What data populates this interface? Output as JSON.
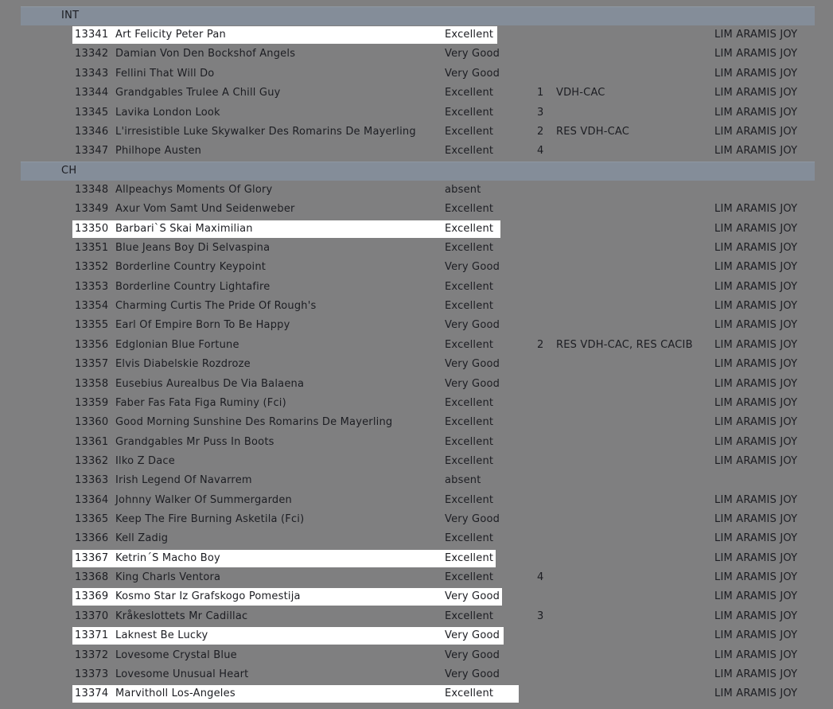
{
  "groups": [
    {
      "label": "INT",
      "entries": [
        {
          "no": "13341",
          "name": "Art Felicity Peter Pan",
          "grade": "Excellent",
          "rank": "",
          "award": "",
          "judge": "LIM ARAMIS JOY",
          "highlighted": true
        },
        {
          "no": "13342",
          "name": "Damian Von Den Bockshof Angels",
          "grade": "Very Good",
          "rank": "",
          "award": "",
          "judge": "LIM ARAMIS JOY",
          "highlighted": false
        },
        {
          "no": "13343",
          "name": "Fellini That Will Do",
          "grade": "Very Good",
          "rank": "",
          "award": "",
          "judge": "LIM ARAMIS JOY",
          "highlighted": false
        },
        {
          "no": "13344",
          "name": "Grandgables Trulee A Chill Guy",
          "grade": "Excellent",
          "rank": "1",
          "award": "VDH-CAC",
          "judge": "LIM ARAMIS JOY",
          "highlighted": false
        },
        {
          "no": "13345",
          "name": "Lavika London Look",
          "grade": "Excellent",
          "rank": "3",
          "award": "",
          "judge": "LIM ARAMIS JOY",
          "highlighted": false
        },
        {
          "no": "13346",
          "name": "L'irresistible Luke Skywalker Des Romarins De Mayerling",
          "grade": "Excellent",
          "rank": "2",
          "award": "RES VDH-CAC",
          "judge": "LIM ARAMIS JOY",
          "highlighted": false
        },
        {
          "no": "13347",
          "name": "Philhope Austen",
          "grade": "Excellent",
          "rank": "4",
          "award": "",
          "judge": "LIM ARAMIS JOY",
          "highlighted": false
        }
      ]
    },
    {
      "label": "CH",
      "entries": [
        {
          "no": "13348",
          "name": "Allpeachys Moments Of Glory",
          "grade": "absent",
          "rank": "",
          "award": "",
          "judge": "",
          "highlighted": false
        },
        {
          "no": "13349",
          "name": "Axur Vom Samt Und Seidenweber",
          "grade": "Excellent",
          "rank": "",
          "award": "",
          "judge": "LIM ARAMIS JOY",
          "highlighted": false
        },
        {
          "no": "13350",
          "name": "Barbari`S Skai Maximilian",
          "grade": "Excellent",
          "rank": "",
          "award": "",
          "judge": "LIM ARAMIS JOY",
          "highlighted": true
        },
        {
          "no": "13351",
          "name": "Blue Jeans Boy Di Selvaspina",
          "grade": "Excellent",
          "rank": "",
          "award": "",
          "judge": "LIM ARAMIS JOY",
          "highlighted": false
        },
        {
          "no": "13352",
          "name": "Borderline Country Keypoint",
          "grade": "Very Good",
          "rank": "",
          "award": "",
          "judge": "LIM ARAMIS JOY",
          "highlighted": false
        },
        {
          "no": "13353",
          "name": "Borderline Country Lightafire",
          "grade": "Excellent",
          "rank": "",
          "award": "",
          "judge": "LIM ARAMIS JOY",
          "highlighted": false
        },
        {
          "no": "13354",
          "name": "Charming Curtis The Pride Of Rough's",
          "grade": "Excellent",
          "rank": "",
          "award": "",
          "judge": "LIM ARAMIS JOY",
          "highlighted": false
        },
        {
          "no": "13355",
          "name": "Earl Of Empire Born To Be Happy",
          "grade": "Very Good",
          "rank": "",
          "award": "",
          "judge": "LIM ARAMIS JOY",
          "highlighted": false
        },
        {
          "no": "13356",
          "name": "Edglonian Blue Fortune",
          "grade": "Excellent",
          "rank": "2",
          "award": "RES VDH-CAC, RES CACIB",
          "judge": "LIM ARAMIS JOY",
          "highlighted": false
        },
        {
          "no": "13357",
          "name": "Elvis Diabelskie Rozdroze",
          "grade": "Very Good",
          "rank": "",
          "award": "",
          "judge": "LIM ARAMIS JOY",
          "highlighted": false
        },
        {
          "no": "13358",
          "name": "Eusebius Aurealbus De Via Balaena",
          "grade": "Very Good",
          "rank": "",
          "award": "",
          "judge": "LIM ARAMIS JOY",
          "highlighted": false
        },
        {
          "no": "13359",
          "name": "Faber Fas Fata Figa Ruminy (Fci)",
          "grade": "Excellent",
          "rank": "",
          "award": "",
          "judge": "LIM ARAMIS JOY",
          "highlighted": false
        },
        {
          "no": "13360",
          "name": "Good Morning Sunshine Des Romarins De Mayerling",
          "grade": "Excellent",
          "rank": "",
          "award": "",
          "judge": "LIM ARAMIS JOY",
          "highlighted": false
        },
        {
          "no": "13361",
          "name": "Grandgables Mr Puss In Boots",
          "grade": "Excellent",
          "rank": "",
          "award": "",
          "judge": "LIM ARAMIS JOY",
          "highlighted": false
        },
        {
          "no": "13362",
          "name": "Ilko Z Dace",
          "grade": "Excellent",
          "rank": "",
          "award": "",
          "judge": "LIM ARAMIS JOY",
          "highlighted": false
        },
        {
          "no": "13363",
          "name": "Irish Legend Of Navarrem",
          "grade": "absent",
          "rank": "",
          "award": "",
          "judge": "",
          "highlighted": false
        },
        {
          "no": "13364",
          "name": "Johnny Walker Of Summergarden",
          "grade": "Excellent",
          "rank": "",
          "award": "",
          "judge": "LIM ARAMIS JOY",
          "highlighted": false
        },
        {
          "no": "13365",
          "name": "Keep The Fire Burning Asketila (Fci)",
          "grade": "Very Good",
          "rank": "",
          "award": "",
          "judge": "LIM ARAMIS JOY",
          "highlighted": false
        },
        {
          "no": "13366",
          "name": "Kell Zadig",
          "grade": "Excellent",
          "rank": "",
          "award": "",
          "judge": "LIM ARAMIS JOY",
          "highlighted": false
        },
        {
          "no": "13367",
          "name": "Ketrin´S Macho Boy",
          "grade": "Excellent",
          "rank": "",
          "award": "",
          "judge": "LIM ARAMIS JOY",
          "highlighted": true
        },
        {
          "no": "13368",
          "name": "King Charls Ventora",
          "grade": "Excellent",
          "rank": "4",
          "award": "",
          "judge": "LIM ARAMIS JOY",
          "highlighted": false
        },
        {
          "no": "13369",
          "name": "Kosmo Star Iz Grafskogo Pomestija",
          "grade": "Very Good",
          "rank": "",
          "award": "",
          "judge": "LIM ARAMIS JOY",
          "highlighted": true
        },
        {
          "no": "13370",
          "name": "Kråkeslottets Mr Cadillac",
          "grade": "Excellent",
          "rank": "3",
          "award": "",
          "judge": "LIM ARAMIS JOY",
          "highlighted": false
        },
        {
          "no": "13371",
          "name": "Laknest Be Lucky",
          "grade": "Very Good",
          "rank": "",
          "award": "",
          "judge": "LIM ARAMIS JOY",
          "highlighted": true
        },
        {
          "no": "13372",
          "name": "Lovesome Crystal Blue",
          "grade": "Very Good",
          "rank": "",
          "award": "",
          "judge": "LIM ARAMIS JOY",
          "highlighted": false
        },
        {
          "no": "13373",
          "name": "Lovesome Unusual Heart",
          "grade": "Very Good",
          "rank": "",
          "award": "",
          "judge": "LIM ARAMIS JOY",
          "highlighted": false
        },
        {
          "no": "13374",
          "name": "Marvitholl Los-Angeles",
          "grade": "Excellent",
          "rank": "",
          "award": "",
          "judge": "LIM ARAMIS JOY",
          "highlighted": true
        }
      ]
    }
  ]
}
